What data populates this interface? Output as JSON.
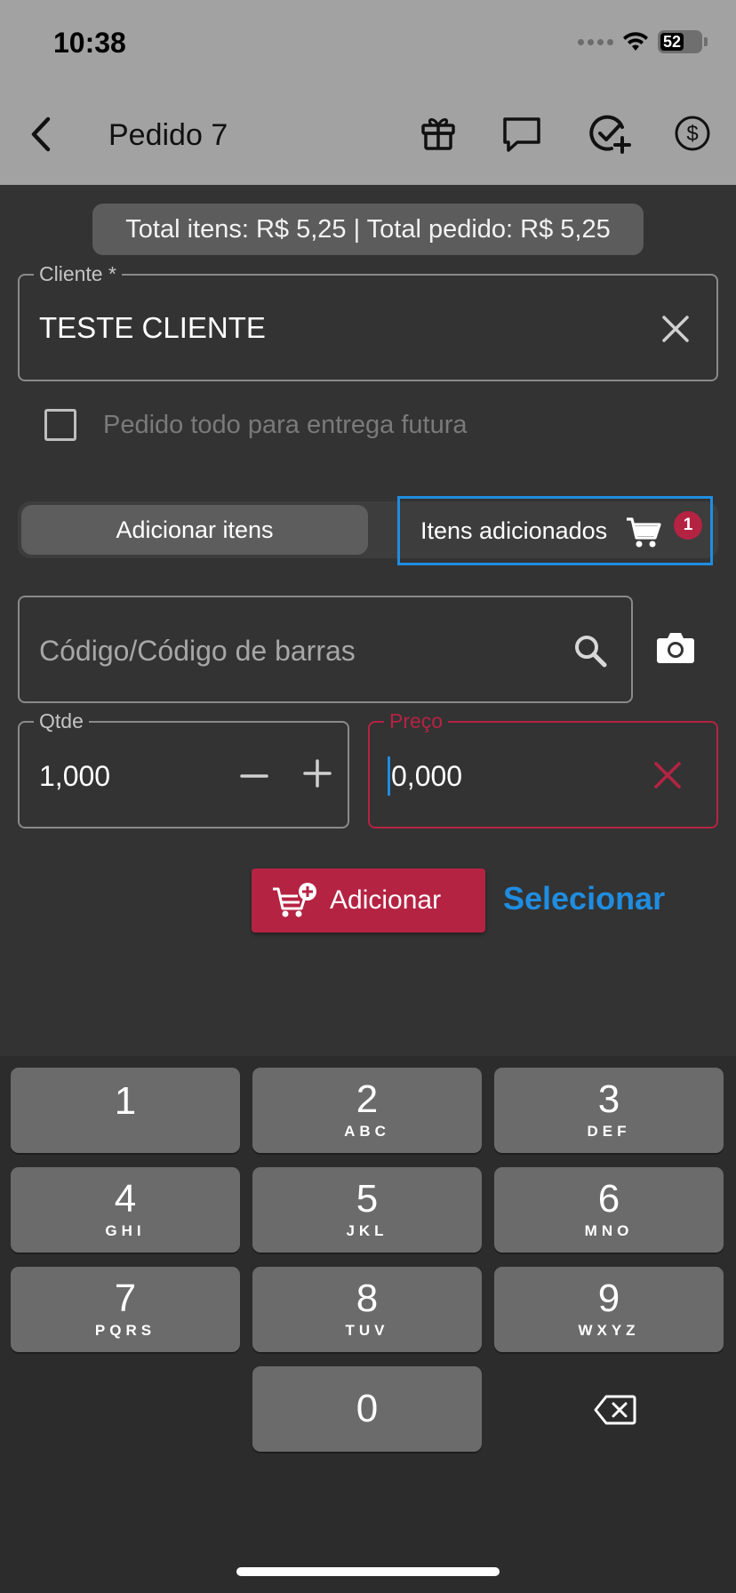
{
  "status_bar": {
    "time": "10:38",
    "battery": "52"
  },
  "app_bar": {
    "title": "Pedido 7"
  },
  "totals": {
    "text": "Total itens: R$ 5,25 | Total pedido: R$ 5,25"
  },
  "cliente": {
    "label": "Cliente *",
    "value": "TESTE CLIENTE"
  },
  "entrega_futura": {
    "label": "Pedido todo para entrega futura",
    "checked": false
  },
  "tabs": {
    "add_items": "Adicionar itens",
    "added_items": "Itens adicionados",
    "added_count": "1"
  },
  "codigo": {
    "placeholder": "Código/Código de barras"
  },
  "qtde": {
    "label": "Qtde",
    "value": "1,000"
  },
  "preco": {
    "label": "Preço",
    "value": "0,000"
  },
  "actions": {
    "add_label": "Adicionar",
    "select_label": "Selecionar"
  },
  "keyboard": {
    "keys": [
      {
        "digit": "1",
        "letters": ""
      },
      {
        "digit": "2",
        "letters": "ABC"
      },
      {
        "digit": "3",
        "letters": "DEF"
      },
      {
        "digit": "4",
        "letters": "GHI"
      },
      {
        "digit": "5",
        "letters": "JKL"
      },
      {
        "digit": "6",
        "letters": "MNO"
      },
      {
        "digit": "7",
        "letters": "PQRS"
      },
      {
        "digit": "8",
        "letters": "TUV"
      },
      {
        "digit": "9",
        "letters": "WXYZ"
      },
      {
        "digit": "0",
        "letters": ""
      }
    ]
  },
  "colors": {
    "accent_red": "#b52343",
    "accent_blue": "#1f8de0",
    "background": "#333333",
    "app_bar": "#a2a2a2"
  },
  "icons": [
    "back-icon",
    "gift-icon",
    "chat-icon",
    "check-plus-icon",
    "dollar-icon",
    "close-icon",
    "cart-icon",
    "search-icon",
    "camera-icon",
    "minus-icon",
    "plus-icon",
    "cart-add-icon",
    "backspace-icon"
  ]
}
